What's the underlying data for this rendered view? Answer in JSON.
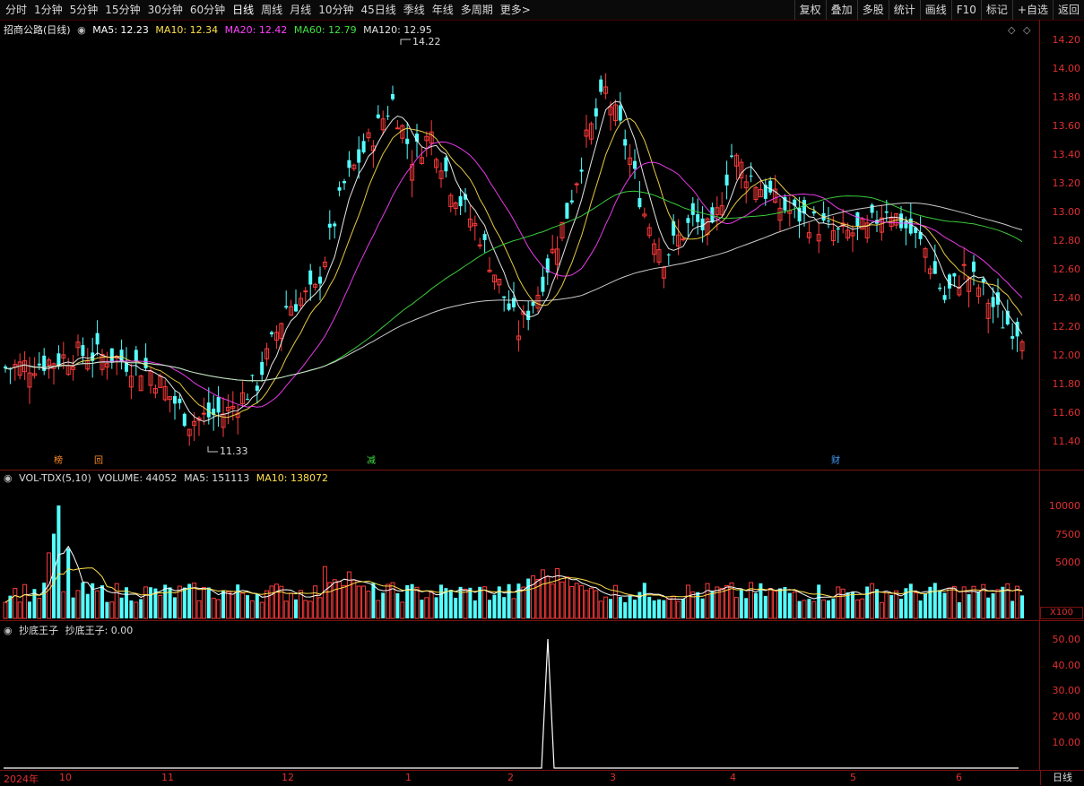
{
  "toolbar": {
    "periods": [
      "分时",
      "1分钟",
      "5分钟",
      "15分钟",
      "30分钟",
      "60分钟",
      "日线",
      "周线",
      "月线",
      "10分钟",
      "45日线",
      "季线",
      "年线",
      "多周期",
      "更多>"
    ],
    "active_period": "日线",
    "right_buttons": [
      "复权",
      "叠加",
      "多股",
      "统计",
      "画线",
      "F10",
      "标记",
      "+自选",
      "返回"
    ]
  },
  "main": {
    "stock_label": "招商公路(日线)",
    "ma": [
      {
        "label": "MA5: 12.23",
        "color": "#ffffff"
      },
      {
        "label": "MA10: 12.34",
        "color": "#ffe04a"
      },
      {
        "label": "MA20: 12.42",
        "color": "#ff40ff"
      },
      {
        "label": "MA60: 12.79",
        "color": "#40e040"
      },
      {
        "label": "MA120: 12.95",
        "color": "#e0e0e0"
      }
    ],
    "y_ticks": [
      "14.20",
      "14.00",
      "13.80",
      "13.60",
      "13.40",
      "13.20",
      "13.00",
      "12.80",
      "12.60",
      "12.40",
      "12.20",
      "12.00",
      "11.80",
      "11.60",
      "11.40"
    ],
    "high_label": "14.22",
    "low_label": "11.33",
    "badges": [
      {
        "text": "榜",
        "color": "#ff8c2a"
      },
      {
        "text": "回",
        "color": "#ff8c2a"
      },
      {
        "text": "减",
        "color": "#40e040"
      },
      {
        "text": "财",
        "color": "#40a0ff"
      }
    ]
  },
  "volume": {
    "legend": [
      {
        "label": "VOL-TDX(5,10)",
        "color": "#dddddd"
      },
      {
        "label": "VOLUME: 44052",
        "color": "#dddddd"
      },
      {
        "label": "MA5: 151113",
        "color": "#dddddd"
      },
      {
        "label": "MA10: 138072",
        "color": "#ffe04a"
      }
    ],
    "y_ticks": [
      "10000",
      "7500",
      "5000"
    ],
    "unit": "X100"
  },
  "indicator": {
    "legend": [
      {
        "label": "抄底王子",
        "color": "#dddddd"
      },
      {
        "label": "抄底王子: 0.00",
        "color": "#dddddd"
      }
    ],
    "y_ticks": [
      "50.00",
      "40.00",
      "30.00",
      "20.00",
      "10.00"
    ]
  },
  "x_axis": {
    "labels": [
      "2024年",
      "10",
      "11",
      "12",
      "1",
      "2",
      "3",
      "4",
      "5",
      "6"
    ]
  },
  "corner_label": "日线",
  "colors": {
    "up": "#ff3b3b",
    "down": "#54ffff",
    "axis": "#e03030"
  }
}
